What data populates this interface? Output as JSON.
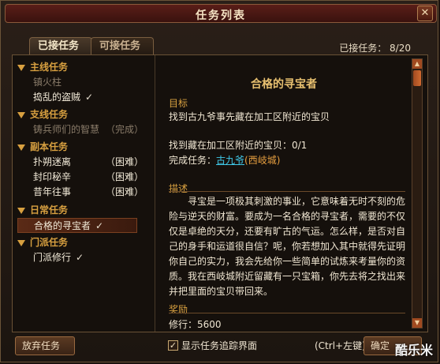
{
  "window": {
    "title": "任务列表",
    "close_icon": "close-icon"
  },
  "tabs": [
    {
      "label": "已接任务",
      "active": true
    },
    {
      "label": "可接任务",
      "active": false
    }
  ],
  "accepted_count": "已接任务： 8/20",
  "quest_list": {
    "main": {
      "label": "主线任务",
      "items": [
        {
          "label": "镇火柱"
        },
        {
          "label": "捣乱的盗贼",
          "check": "✓"
        }
      ]
    },
    "side": {
      "label": "支线任务",
      "items": [
        {
          "label": "铸兵师们的智慧",
          "status": "（完成）"
        }
      ]
    },
    "dungeon": {
      "label": "副本任务",
      "items": [
        {
          "label": "扑朔迷离",
          "difficulty": "（困难）"
        },
        {
          "label": "封印秘辛",
          "difficulty": "（困难）"
        },
        {
          "label": "昔年往事",
          "difficulty": "（困难）"
        }
      ]
    },
    "daily": {
      "label": "日常任务",
      "items": [
        {
          "label": "合格的寻宝者",
          "check": "✓"
        }
      ]
    },
    "sect": {
      "label": "门派任务",
      "items": [
        {
          "label": "门派修行",
          "check": "✓"
        }
      ]
    }
  },
  "detail": {
    "title": "合格的寻宝者",
    "goal_heading": "目标",
    "goal_text": "找到古九爷事先藏在加工区附近的宝贝",
    "progress": "找到藏在加工区附近的宝贝：0/1",
    "complete_label": "完成任务：",
    "complete_npc": "古九爷",
    "complete_place": "(西岐城)",
    "desc_heading": "描述",
    "description": "寻宝是一项极其刺激的事业，它意味着无时不刻的危险与逆天的财富。要成为一名合格的寻宝者，需要的不仅仅是卓绝的天分，还要有旷古的气运。怎么样，是否对自己的身手和运道很自信？呢，你若想加入其中就得先证明你自己的实力，我会先给你一些简单的试炼来考量你的资质。我在西岐城附近留藏有一只宝箱，你先去将之找出来并把里面的宝贝带回来。",
    "reward_heading": "奖励",
    "reward_text": "修行：5600"
  },
  "bottom": {
    "abandon_label": "放弃任务",
    "track_checkbox": "✓",
    "track_label": "显示任务追踪界面",
    "shortcut": "(Ctrl+左键)",
    "ok_label": "确定"
  },
  "watermark": "酷乐米"
}
